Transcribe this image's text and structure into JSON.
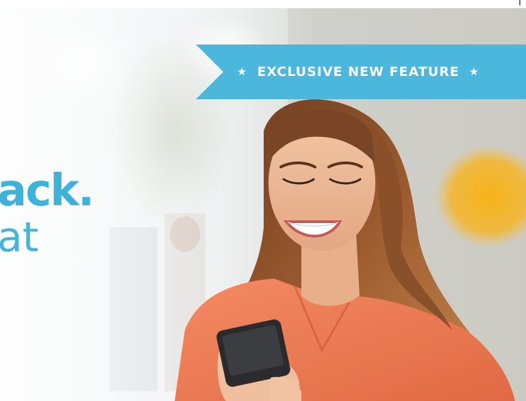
{
  "banner": {
    "ribbon_label": "EXCLUSIVE NEW FEATURE",
    "ribbon_star_left": "★",
    "ribbon_star_right": "★",
    "headline_primary": "ack.",
    "headline_secondary": "at"
  },
  "colors": {
    "accent_blue": "#4bb7dd",
    "headline_blue": "#3fb2da",
    "ribbon_text": "#ffffff"
  },
  "icons": {
    "ribbon_star": "star-icon",
    "phone": "smartphone-icon"
  }
}
